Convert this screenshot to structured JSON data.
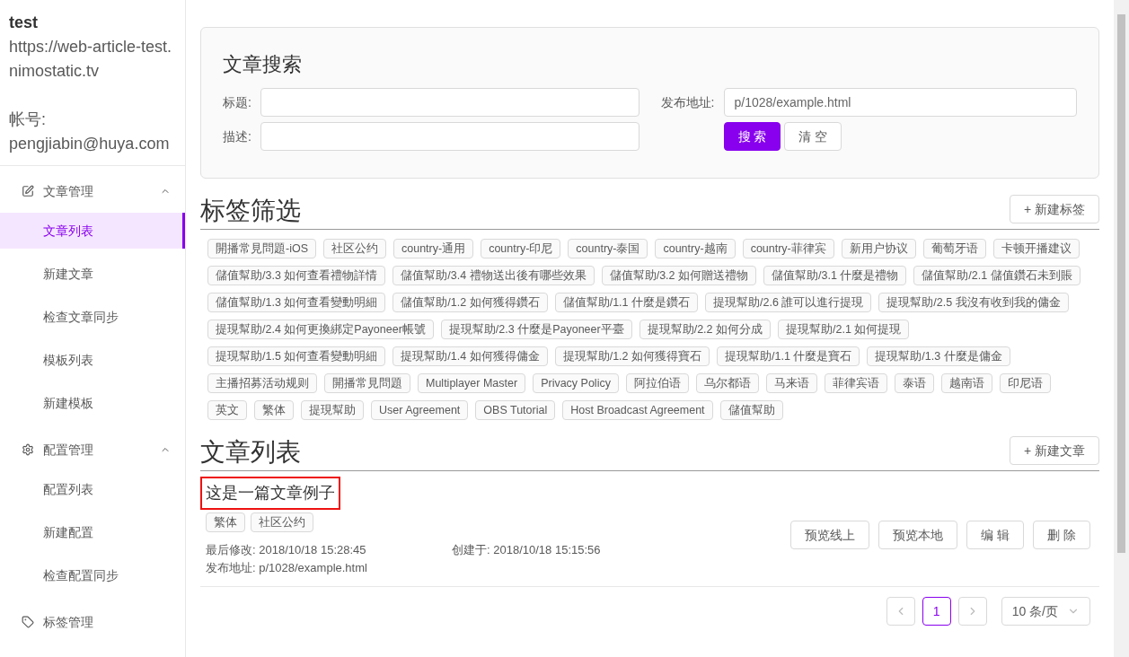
{
  "sidebar": {
    "site_name": "test",
    "site_url": "https://web-article-test.nimostatic.tv",
    "account_label": "帐号:",
    "account": "pengjiabin@huya.com",
    "menu": [
      {
        "kind": "group",
        "label": "文章管理",
        "expanded": true,
        "children": [
          {
            "label": "文章列表",
            "selected": true
          },
          {
            "label": "新建文章",
            "selected": false
          },
          {
            "label": "检查文章同步",
            "selected": false
          },
          {
            "label": "模板列表",
            "selected": false
          },
          {
            "label": "新建模板",
            "selected": false
          }
        ]
      },
      {
        "kind": "group",
        "label": "配置管理",
        "expanded": true,
        "children": [
          {
            "label": "配置列表",
            "selected": false
          },
          {
            "label": "新建配置",
            "selected": false
          },
          {
            "label": "检查配置同步",
            "selected": false
          }
        ]
      },
      {
        "kind": "item",
        "label": "标签管理"
      }
    ]
  },
  "search": {
    "title": "文章搜索",
    "fields": [
      {
        "label": "标题:"
      },
      {
        "label": "描述:"
      }
    ],
    "url_field": {
      "label": "发布地址:",
      "placeholder": "p/1028/example.html"
    },
    "buttons": [
      {
        "label": "搜 索",
        "kind": "primary"
      },
      {
        "label": "清 空",
        "kind": "default"
      }
    ]
  },
  "tags_section": {
    "title": "标签筛选",
    "new_button": "+ 新建标签",
    "tags": [
      "開播常見問題-iOS",
      "社区公约",
      "country-通用",
      "country-印尼",
      "country-泰国",
      "country-越南",
      "country-菲律宾",
      "新用户协议",
      "葡萄牙语",
      "卡顿开播建议",
      "儲值幫助/3.3 如何查看禮物詳情",
      "儲值幫助/3.4 禮物送出後有哪些效果",
      "儲值幫助/3.2 如何贈送禮物",
      "儲值幫助/3.1 什麼是禮物",
      "儲值幫助/2.1 儲值鑽石未到賬",
      "儲值幫助/1.3 如何查看變動明細",
      "儲值幫助/1.2 如何獲得鑽石",
      "儲值幫助/1.1 什麼是鑽石",
      "提現幫助/2.6 誰可以進行提現",
      "提現幫助/2.5 我沒有收到我的傭金",
      "提現幫助/2.4 如何更換綁定Payoneer帳號",
      "提現幫助/2.3 什麼是Payoneer平臺",
      "提現幫助/2.2 如何分成",
      "提現幫助/2.1 如何提現",
      "提現幫助/1.5 如何查看變動明細",
      "提現幫助/1.4 如何獲得傭金",
      "提現幫助/1.2 如何獲得寶石",
      "提現幫助/1.1 什麼是寶石",
      "提現幫助/1.3 什麼是傭金",
      "主播招募活动规则",
      "開播常見問題",
      "Multiplayer Master",
      "Privacy Policy",
      "阿拉伯语",
      "乌尔都语",
      "马来语",
      "菲律宾语",
      "泰语",
      "越南语",
      "印尼语",
      "英文",
      "繁体",
      "提現幫助",
      "User Agreement",
      "OBS Tutorial",
      "Host Broadcast Agreement",
      "儲值幫助"
    ]
  },
  "articles_section": {
    "title": "文章列表",
    "new_button": "+ 新建文章",
    "articles": [
      {
        "title": "这是一篇文章例子",
        "highlighted": true,
        "tags": [
          "繁体",
          "社区公约"
        ],
        "modified_label": "最后修改:",
        "modified": "2018/10/18 15:28:45",
        "created_label": "创建于:",
        "created": "2018/10/18 15:15:56",
        "url_label": "发布地址:",
        "url": "p/1028/example.html",
        "actions": [
          "预览线上",
          "预览本地",
          "编 辑",
          "删 除"
        ]
      }
    ],
    "pagination": {
      "pages": [
        {
          "label": "1",
          "selected": true
        }
      ],
      "page_size": "10 条/页"
    }
  }
}
